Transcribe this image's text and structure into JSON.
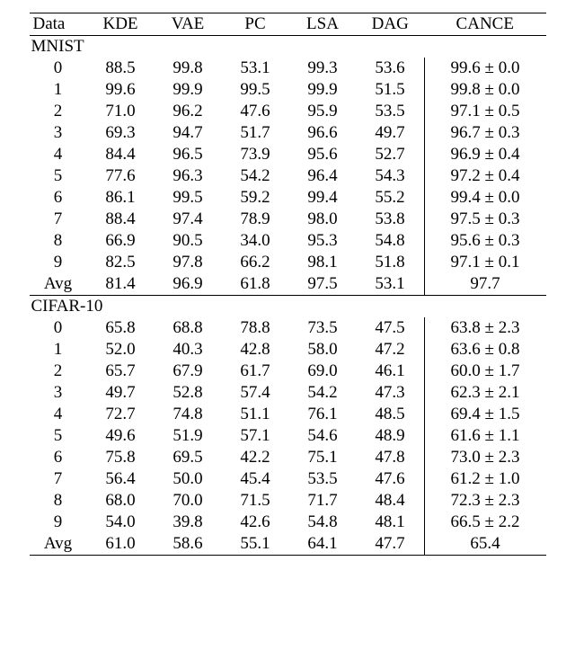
{
  "chart_data": {
    "type": "table",
    "columns": [
      "Data",
      "KDE",
      "VAE",
      "PC",
      "LSA",
      "DAG",
      "CANCE"
    ],
    "sections": [
      {
        "label": "MNIST",
        "rows": [
          {
            "data": "0",
            "kde": "88.5",
            "vae": "99.8",
            "pc": "53.1",
            "lsa": "99.3",
            "dag": "53.6",
            "cance": "99.6 ± 0.0"
          },
          {
            "data": "1",
            "kde": "99.6",
            "vae": "99.9",
            "pc": "99.5",
            "lsa": "99.9",
            "dag": "51.5",
            "cance": "99.8 ± 0.0"
          },
          {
            "data": "2",
            "kde": "71.0",
            "vae": "96.2",
            "pc": "47.6",
            "lsa": "95.9",
            "dag": "53.5",
            "cance": "97.1 ± 0.5"
          },
          {
            "data": "3",
            "kde": "69.3",
            "vae": "94.7",
            "pc": "51.7",
            "lsa": "96.6",
            "dag": "49.7",
            "cance": "96.7 ± 0.3"
          },
          {
            "data": "4",
            "kde": "84.4",
            "vae": "96.5",
            "pc": "73.9",
            "lsa": "95.6",
            "dag": "52.7",
            "cance": "96.9 ± 0.4"
          },
          {
            "data": "5",
            "kde": "77.6",
            "vae": "96.3",
            "pc": "54.2",
            "lsa": "96.4",
            "dag": "54.3",
            "cance": "97.2 ± 0.4"
          },
          {
            "data": "6",
            "kde": "86.1",
            "vae": "99.5",
            "pc": "59.2",
            "lsa": "99.4",
            "dag": "55.2",
            "cance": "99.4 ± 0.0"
          },
          {
            "data": "7",
            "kde": "88.4",
            "vae": "97.4",
            "pc": "78.9",
            "lsa": "98.0",
            "dag": "53.8",
            "cance": "97.5 ± 0.3"
          },
          {
            "data": "8",
            "kde": "66.9",
            "vae": "90.5",
            "pc": "34.0",
            "lsa": "95.3",
            "dag": "54.8",
            "cance": "95.6 ± 0.3"
          },
          {
            "data": "9",
            "kde": "82.5",
            "vae": "97.8",
            "pc": "66.2",
            "lsa": "98.1",
            "dag": "51.8",
            "cance": "97.1 ± 0.1"
          },
          {
            "data": "Avg",
            "kde": "81.4",
            "vae": "96.9",
            "pc": "61.8",
            "lsa": "97.5",
            "dag": "53.1",
            "cance": "97.7"
          }
        ]
      },
      {
        "label": "CIFAR-10",
        "rows": [
          {
            "data": "0",
            "kde": "65.8",
            "vae": "68.8",
            "pc": "78.8",
            "lsa": "73.5",
            "dag": "47.5",
            "cance": "63.8 ± 2.3"
          },
          {
            "data": "1",
            "kde": "52.0",
            "vae": "40.3",
            "pc": "42.8",
            "lsa": "58.0",
            "dag": "47.2",
            "cance": "63.6 ± 0.8"
          },
          {
            "data": "2",
            "kde": "65.7",
            "vae": "67.9",
            "pc": "61.7",
            "lsa": "69.0",
            "dag": "46.1",
            "cance": "60.0 ± 1.7"
          },
          {
            "data": "3",
            "kde": "49.7",
            "vae": "52.8",
            "pc": "57.4",
            "lsa": "54.2",
            "dag": "47.3",
            "cance": "62.3 ± 2.1"
          },
          {
            "data": "4",
            "kde": "72.7",
            "vae": "74.8",
            "pc": "51.1",
            "lsa": "76.1",
            "dag": "48.5",
            "cance": "69.4 ± 1.5"
          },
          {
            "data": "5",
            "kde": "49.6",
            "vae": "51.9",
            "pc": "57.1",
            "lsa": "54.6",
            "dag": "48.9",
            "cance": "61.6 ± 1.1"
          },
          {
            "data": "6",
            "kde": "75.8",
            "vae": "69.5",
            "pc": "42.2",
            "lsa": "75.1",
            "dag": "47.8",
            "cance": "73.0 ± 2.3"
          },
          {
            "data": "7",
            "kde": "56.4",
            "vae": "50.0",
            "pc": "45.4",
            "lsa": "53.5",
            "dag": "47.6",
            "cance": "61.2 ± 1.0"
          },
          {
            "data": "8",
            "kde": "68.0",
            "vae": "70.0",
            "pc": "71.5",
            "lsa": "71.7",
            "dag": "48.4",
            "cance": "72.3 ± 2.3"
          },
          {
            "data": "9",
            "kde": "54.0",
            "vae": "39.8",
            "pc": "42.6",
            "lsa": "54.8",
            "dag": "48.1",
            "cance": "66.5 ± 2.2"
          },
          {
            "data": "Avg",
            "kde": "61.0",
            "vae": "58.6",
            "pc": "55.1",
            "lsa": "64.1",
            "dag": "47.7",
            "cance": "65.4"
          }
        ]
      }
    ]
  }
}
